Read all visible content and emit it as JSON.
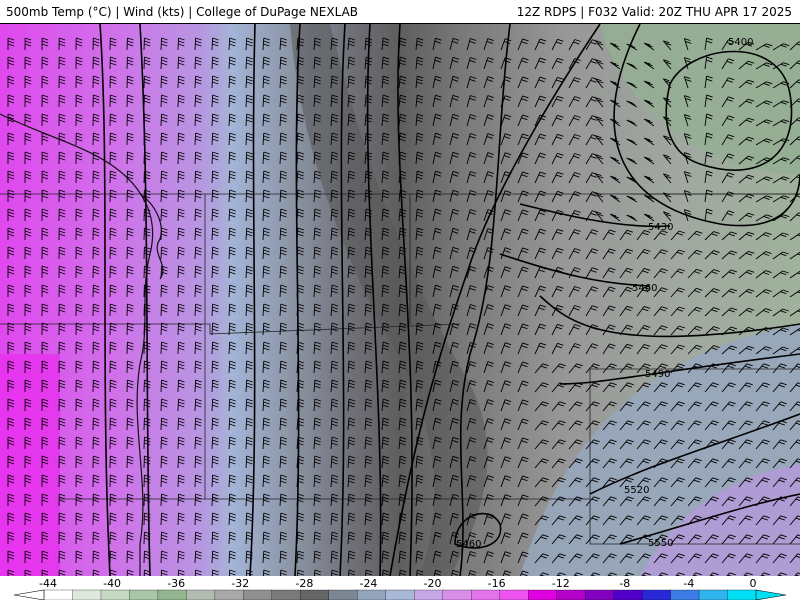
{
  "header": {
    "left_title": "500mb Temp (°C) | Wind (kts) | College of DuPage NEXLAB",
    "right_title": "12Z RDPS | F032 Valid: 20Z THU APR 17 2025"
  },
  "contours": {
    "height_labels": [
      "5400",
      "5430",
      "5460",
      "5490",
      "5520",
      "5550",
      "5460"
    ]
  },
  "colorbar": {
    "tick_labels": [
      "-44",
      "-40",
      "-36",
      "-32",
      "-28",
      "-24",
      "-20",
      "-16",
      "-12",
      "-8",
      "-4",
      "0"
    ],
    "colors": [
      "#ffffff",
      "#dde9dc",
      "#c4d8c2",
      "#a9c6a6",
      "#93b590",
      "#b3bcb3",
      "#a8a8a8",
      "#8f8f8f",
      "#7a7a7a",
      "#656565",
      "#7c8794",
      "#93a4bd",
      "#a9b8d6",
      "#c7a6e8",
      "#d98ee8",
      "#e474ec",
      "#ee52f0",
      "#e000e0",
      "#b400c8",
      "#8200c0",
      "#5000c8",
      "#2828d8",
      "#3c7ce6",
      "#30b4ee",
      "#00e0f4"
    ]
  }
}
